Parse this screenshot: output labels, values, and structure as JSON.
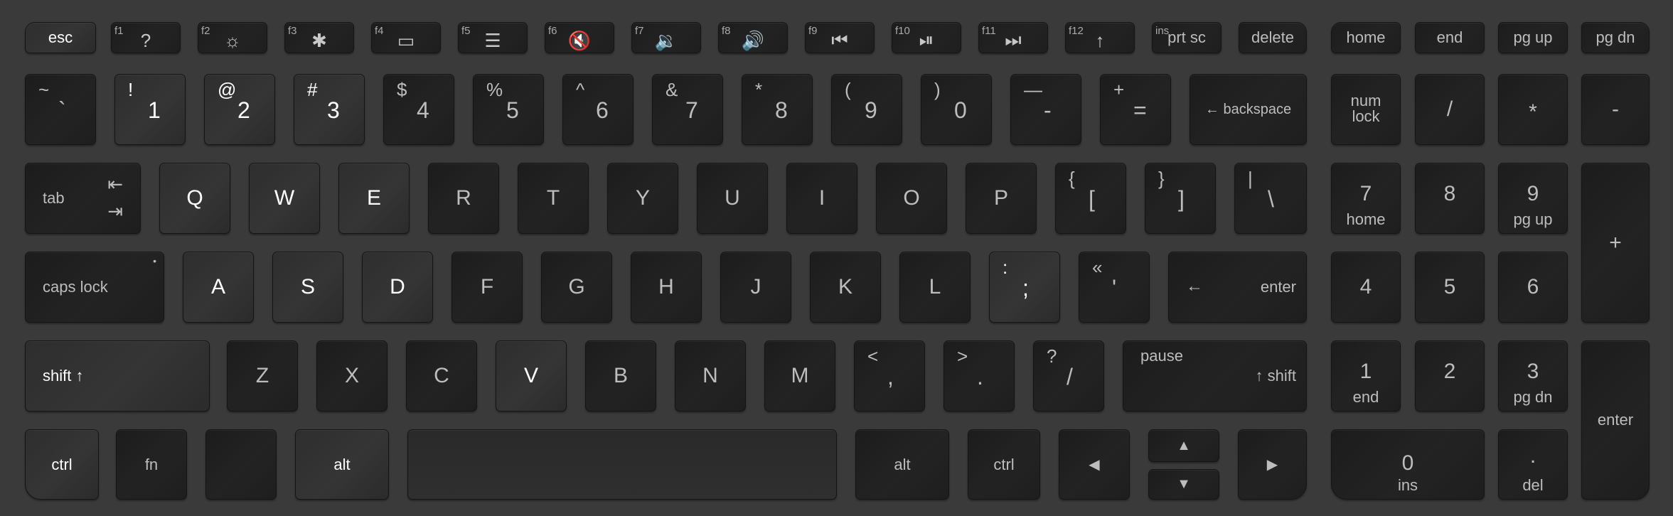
{
  "keys": {
    "esc": "esc",
    "f1": {
      "num": "f1",
      "glyph": "?"
    },
    "f2": {
      "num": "f2",
      "glyph": "☼"
    },
    "f3": {
      "num": "f3",
      "glyph": "✱"
    },
    "f4": {
      "num": "f4",
      "glyph": "▭"
    },
    "f5": {
      "num": "f5",
      "glyph": "☰"
    },
    "f6": {
      "num": "f6",
      "glyph": "🔇"
    },
    "f7": {
      "num": "f7",
      "glyph": "🔉"
    },
    "f8": {
      "num": "f8",
      "glyph": "🔊"
    },
    "f9": {
      "num": "f9",
      "glyph": "⏮"
    },
    "f10": {
      "num": "f10",
      "glyph": "⏯"
    },
    "f11": {
      "num": "f11",
      "glyph": "⏭"
    },
    "f12": {
      "num": "f12",
      "glyph": "↑"
    },
    "prtsc": {
      "num": "ins",
      "label": "prt sc"
    },
    "delete": "delete",
    "home": "home",
    "end": "end",
    "pgup": "pg up",
    "pgdn": "pg dn",
    "num_row": [
      {
        "shift": "~",
        "main": "`"
      },
      {
        "shift": "!",
        "main": "1"
      },
      {
        "shift": "@",
        "main": "2"
      },
      {
        "shift": "#",
        "main": "3"
      },
      {
        "shift": "$",
        "main": "4"
      },
      {
        "shift": "%",
        "main": "5"
      },
      {
        "shift": "^",
        "main": "6"
      },
      {
        "shift": "&",
        "main": "7"
      },
      {
        "shift": "*",
        "main": "8"
      },
      {
        "shift": "(",
        "main": "9"
      },
      {
        "shift": ")",
        "main": "0"
      },
      {
        "shift": "—",
        "main": "-"
      },
      {
        "shift": "+",
        "main": "="
      }
    ],
    "backspace": "← backspace",
    "numlock": {
      "line1": "num",
      "line2": "lock"
    },
    "np_slash": "/",
    "np_star": "*",
    "np_minus": "-",
    "tab": {
      "label": "tab",
      "glyph_top": "⇤",
      "glyph_bot": "⇥"
    },
    "qrow": [
      "Q",
      "W",
      "E",
      "R",
      "T",
      "Y",
      "U",
      "I",
      "O",
      "P"
    ],
    "lbracket": {
      "shift": "{",
      "main": "["
    },
    "rbracket": {
      "shift": "}",
      "main": "]"
    },
    "backslash": {
      "shift": "|",
      "main": "\\"
    },
    "np7": {
      "top": "7",
      "bot": "home"
    },
    "np8": "8",
    "np9": {
      "top": "9",
      "bot": "pg up"
    },
    "np_plus": "+",
    "capslock": {
      "label": "caps lock",
      "dot": "•"
    },
    "arow": [
      "A",
      "S",
      "D",
      "F",
      "G",
      "H",
      "J",
      "K",
      "L"
    ],
    "semicolon": {
      "shift": ":",
      "main": ";"
    },
    "quote": {
      "shift": "«",
      "main": "'"
    },
    "enter": {
      "arrow": "←",
      "label": "enter"
    },
    "np4": "4",
    "np5": "5",
    "np6": "6",
    "lshift": "shift ↑",
    "zrow": [
      "Z",
      "X",
      "C",
      "V",
      "B",
      "N",
      "M"
    ],
    "comma": {
      "shift": "<",
      "main": ","
    },
    "period": {
      "shift": ">",
      "main": "."
    },
    "slash": {
      "shift": "?",
      "main": "/"
    },
    "rshift": {
      "top": "pause",
      "main": "↑ shift"
    },
    "np1": {
      "top": "1",
      "bot": "end"
    },
    "np2": "2",
    "np3": {
      "top": "3",
      "bot": "pg dn"
    },
    "np_enter": "enter",
    "lctrl": "ctrl",
    "fn": "fn",
    "blank": "",
    "lalt": "alt",
    "space": "",
    "ralt": "alt",
    "rctrl": "ctrl",
    "left": "◀",
    "up": "▲",
    "down": "▼",
    "right": "▶",
    "np0": {
      "top": "0",
      "bot": "ins"
    },
    "np_dot": {
      "top": ".",
      "bot": "del"
    }
  }
}
